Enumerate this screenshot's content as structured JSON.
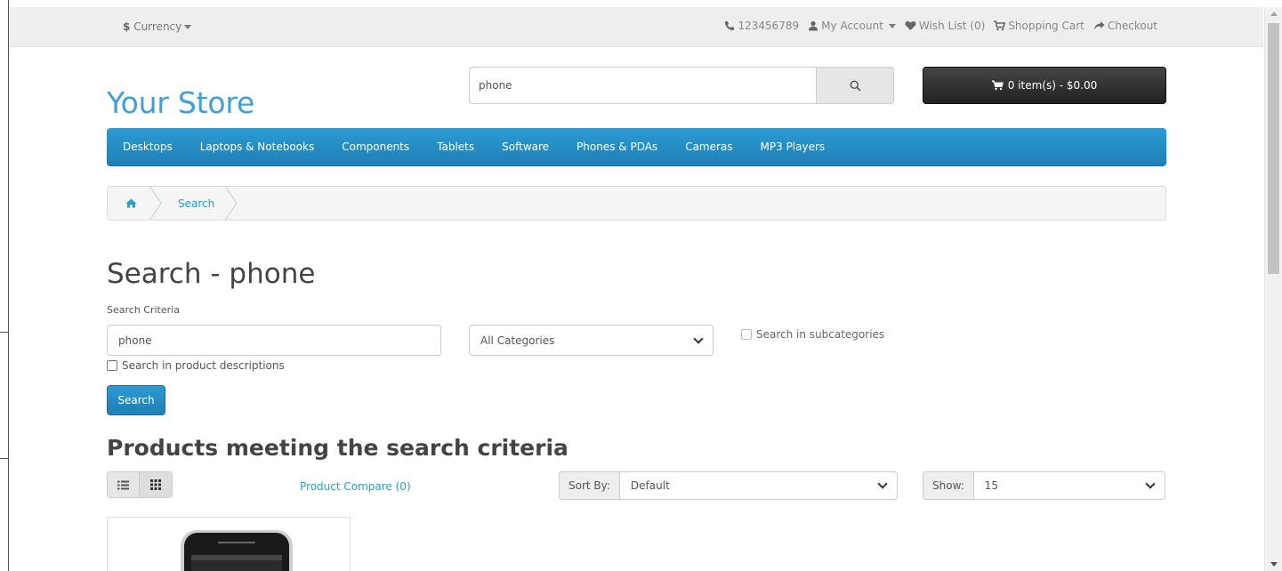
{
  "topbar": {
    "currency_symbol": "$",
    "currency_label": "Currency",
    "phone": "123456789",
    "my_account": "My Account",
    "wish_list": "Wish List (0)",
    "shopping_cart": "Shopping Cart",
    "checkout": "Checkout"
  },
  "header": {
    "logo_text": "Your Store",
    "search_value": "phone",
    "cart_label": "0 item(s) - $0.00"
  },
  "menu": {
    "items": [
      "Desktops",
      "Laptops & Notebooks",
      "Components",
      "Tablets",
      "Software",
      "Phones & PDAs",
      "Cameras",
      "MP3 Players"
    ]
  },
  "breadcrumb": {
    "current": "Search"
  },
  "main": {
    "title": "Search - phone",
    "criteria_label": "Search Criteria",
    "criteria_value": "phone",
    "category_selected": "All Categories",
    "subcategories_label": "Search in subcategories",
    "descriptions_label": "Search in product descriptions",
    "search_button": "Search",
    "results_title": "Products meeting the search criteria",
    "compare_link": "Product Compare (0)",
    "sort_label": "Sort By:",
    "sort_value": "Default",
    "show_label": "Show:",
    "show_value": "15"
  },
  "colors": {
    "brand": "#3ea0d6",
    "menu_blue": "#2291c9",
    "cart_dark": "#2e2e2e"
  }
}
